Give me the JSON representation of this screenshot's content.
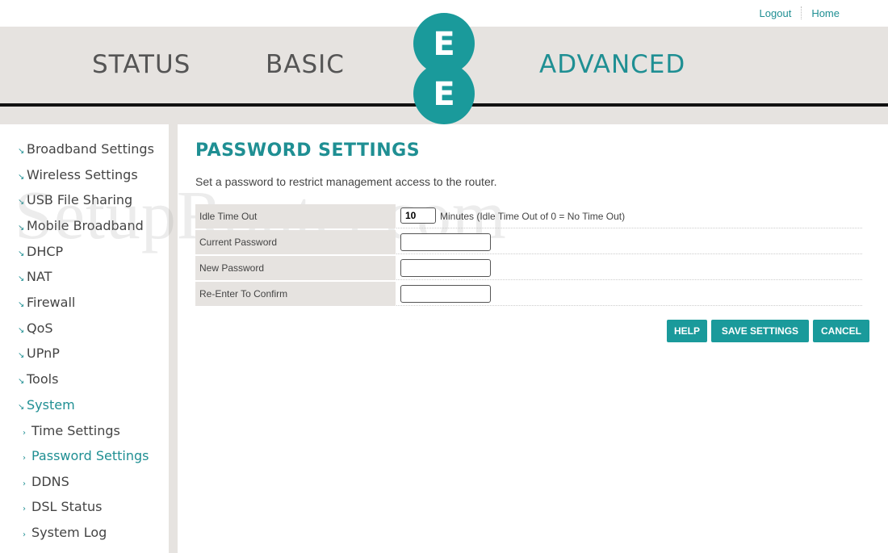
{
  "top_links": {
    "logout": "Logout",
    "home": "Home"
  },
  "nav": {
    "status": "STATUS",
    "basic": "BASIC",
    "advanced": "ADVANCED"
  },
  "logo": {
    "letter_top": "E",
    "letter_bottom": "E"
  },
  "sidebar": {
    "items": [
      {
        "label": "Broadband Settings"
      },
      {
        "label": "Wireless Settings"
      },
      {
        "label": "USB File Sharing"
      },
      {
        "label": "Mobile Broadband"
      },
      {
        "label": "DHCP"
      },
      {
        "label": "NAT"
      },
      {
        "label": "Firewall"
      },
      {
        "label": "QoS"
      },
      {
        "label": "UPnP"
      },
      {
        "label": "Tools"
      },
      {
        "label": "System"
      }
    ],
    "subitems": [
      {
        "label": "Time Settings"
      },
      {
        "label": "Password Settings"
      },
      {
        "label": "DDNS"
      },
      {
        "label": "DSL Status"
      },
      {
        "label": "System Log"
      }
    ]
  },
  "watermark": "SetupRouter.com",
  "main": {
    "title": "PASSWORD SETTINGS",
    "intro": "Set a password to restrict management access to the router.",
    "idle_label": "Idle Time Out",
    "idle_value": "10",
    "idle_note": "Minutes (Idle Time Out of 0 = No Time Out)",
    "current_label": "Current Password",
    "new_label": "New Password",
    "confirm_label": "Re-Enter To Confirm"
  },
  "buttons": {
    "help": "HELP",
    "save": "SAVE SETTINGS",
    "cancel": "CANCEL"
  },
  "colors": {
    "accent": "#1a9a9b",
    "band": "#e6e3e0",
    "nav_inactive": "#555555"
  }
}
